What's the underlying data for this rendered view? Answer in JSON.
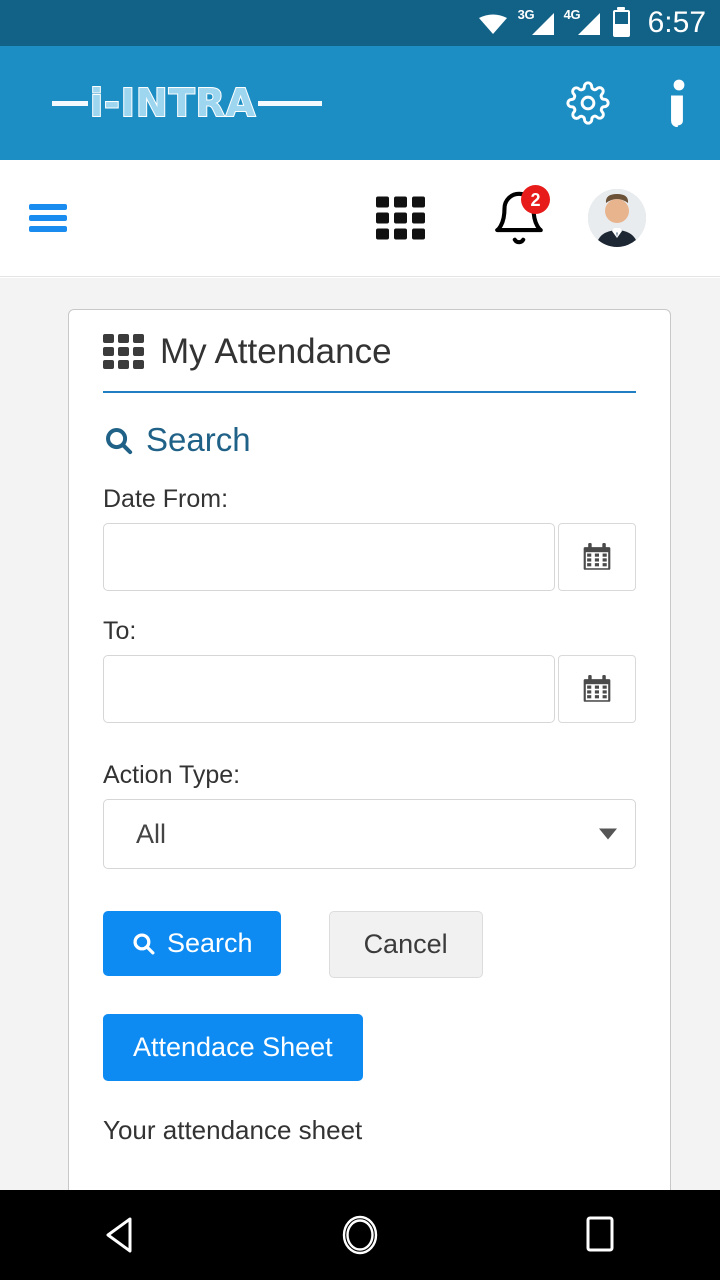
{
  "statusbar": {
    "time": "6:57",
    "wifi_icon": "wifi-icon",
    "signal1_label": "3G",
    "signal2_label": "4G",
    "battery_icon": "battery-icon",
    "battery_level_percent": 50
  },
  "brandbar": {
    "logo_text": "i-INTRA",
    "settings_icon": "gear-icon",
    "info_icon": "info-icon",
    "background_color": "#1c8ec4"
  },
  "navbar": {
    "menu_icon": "hamburger-menu-icon",
    "apps_icon": "apps-grid-icon",
    "notifications_icon": "bell-icon",
    "notifications_count": "2",
    "badge_color": "#e81b1b",
    "avatar_icon": "user-avatar"
  },
  "card": {
    "title": "My Attendance",
    "title_icon": "apps-grid-icon",
    "accent_color": "#1f7fc0",
    "search_section": {
      "icon": "search-icon",
      "label": "Search"
    },
    "fields": [
      {
        "label": "Date From:",
        "value": "",
        "placeholder": "",
        "button_icon": "calendar-icon"
      },
      {
        "label": "To:",
        "value": "",
        "placeholder": "",
        "button_icon": "calendar-icon"
      }
    ],
    "action_type": {
      "label": "Action Type:",
      "selected": "All",
      "caret_icon": "chevron-down-icon"
    },
    "buttons": {
      "search": {
        "label": "Search",
        "icon": "search-icon",
        "color": "#0d8bf2"
      },
      "cancel": {
        "label": "Cancel",
        "color": "#f1f1f1"
      },
      "attendance_sheet": {
        "label": "Attendace Sheet",
        "color": "#0d8bf2"
      }
    },
    "cut_off_text": "Your attendance sheet"
  },
  "androidnav": {
    "back_icon": "back-triangle-icon",
    "home_icon": "home-circle-icon",
    "recents_icon": "recents-square-icon"
  }
}
